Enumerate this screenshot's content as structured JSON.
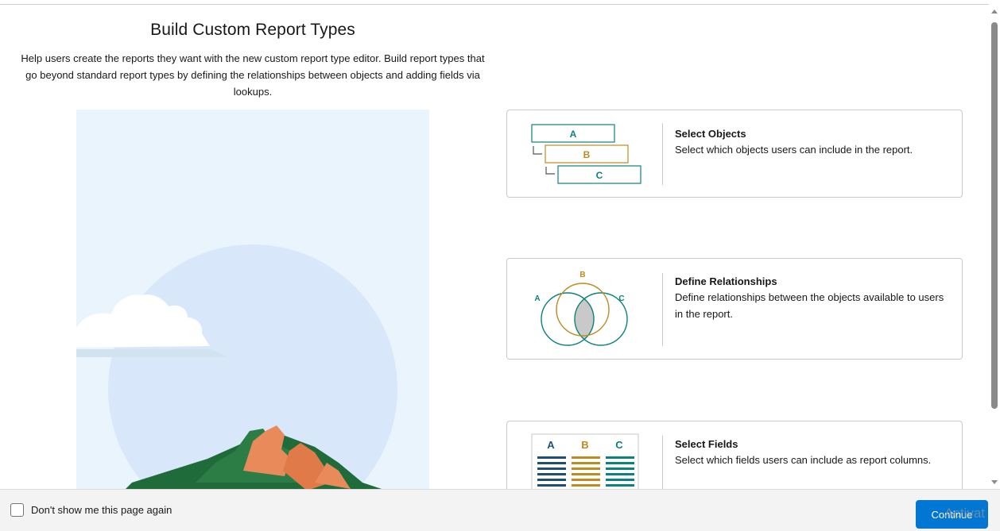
{
  "intro": {
    "title": "Build Custom Report Types",
    "description": "Help users create the reports they want with the new custom report type editor. Build report types that go beyond standard report types by defining the relationships between objects and adding fields via lookups."
  },
  "hero": {
    "icon": "mountain-cloud-illustration"
  },
  "steps": [
    {
      "title": "Select Objects",
      "description": "Select which objects users can include in the report.",
      "icon": "object-hierarchy-icon",
      "labels": [
        "A",
        "B",
        "C"
      ]
    },
    {
      "title": "Define Relationships",
      "description": "Define relationships between the objects available to users in the report.",
      "icon": "venn-diagram-icon",
      "labels": [
        "A",
        "B",
        "C"
      ]
    },
    {
      "title": "Select Fields",
      "description": "Select which fields users can include as report columns.",
      "icon": "field-columns-icon",
      "labels": [
        "A",
        "B",
        "C"
      ]
    }
  ],
  "footer": {
    "checkbox_label": "Don't show me this page again",
    "checkbox_checked": false,
    "continue_label": "Continue"
  },
  "watermark": "Activat",
  "colors": {
    "teal": "#0b827c",
    "gold": "#c08a1f",
    "navy": "#1f4e79",
    "brand": "#0176d3"
  }
}
